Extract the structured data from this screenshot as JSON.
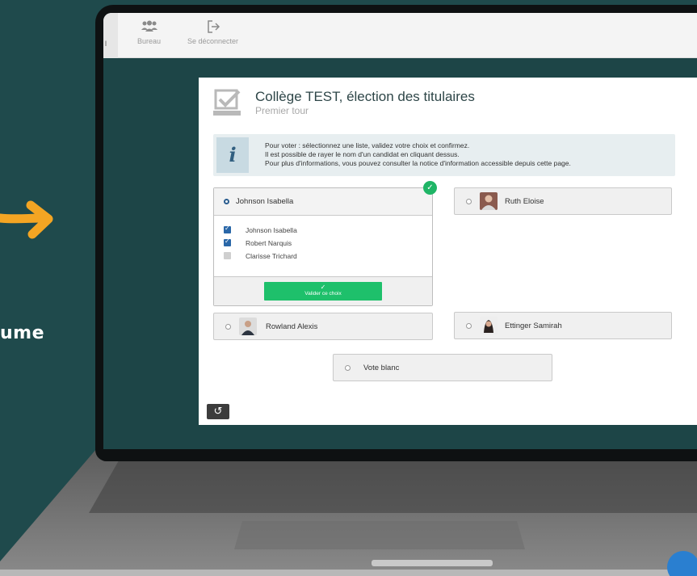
{
  "decor": {
    "partial_text": "ume"
  },
  "nav": {
    "active_label": "l",
    "items": [
      {
        "label": "Bureau",
        "icon": "users-icon"
      },
      {
        "label": "Se déconnecter",
        "icon": "logout-icon"
      }
    ]
  },
  "election": {
    "title": "Collège TEST, élection des titulaires",
    "subtitle": "Premier tour"
  },
  "info": {
    "icon": "info-icon",
    "lines": [
      "Pour voter : sélectionnez une liste, validez votre choix et confirmez.",
      "Il est possible de rayer le nom d'un candidat en cliquant dessus.",
      "Pour plus d'informations, vous pouvez consulter la notice d'information accessible depuis cette page."
    ]
  },
  "selected_list": {
    "name": "Johnson Isabella",
    "candidates": [
      {
        "name": "Johnson Isabella",
        "checked": true
      },
      {
        "name": "Robert Narquis",
        "checked": true
      },
      {
        "name": "Clarisse Trichard",
        "checked": false
      }
    ],
    "validate_label": "Valider ce choix"
  },
  "lists": [
    {
      "name": "Ruth Eloise",
      "photo_color": "#8a5a4e"
    },
    {
      "name": "Rowland Alexis",
      "photo_color": "#2c3440"
    },
    {
      "name": "Ettinger Samirah",
      "photo_color": "#2a2220"
    }
  ],
  "blank_vote": "Vote blanc",
  "colors": {
    "accent_green": "#1ec06b",
    "accent_blue": "#2a67a8",
    "background": "#1f4a4c",
    "arrow": "#f4a523"
  }
}
